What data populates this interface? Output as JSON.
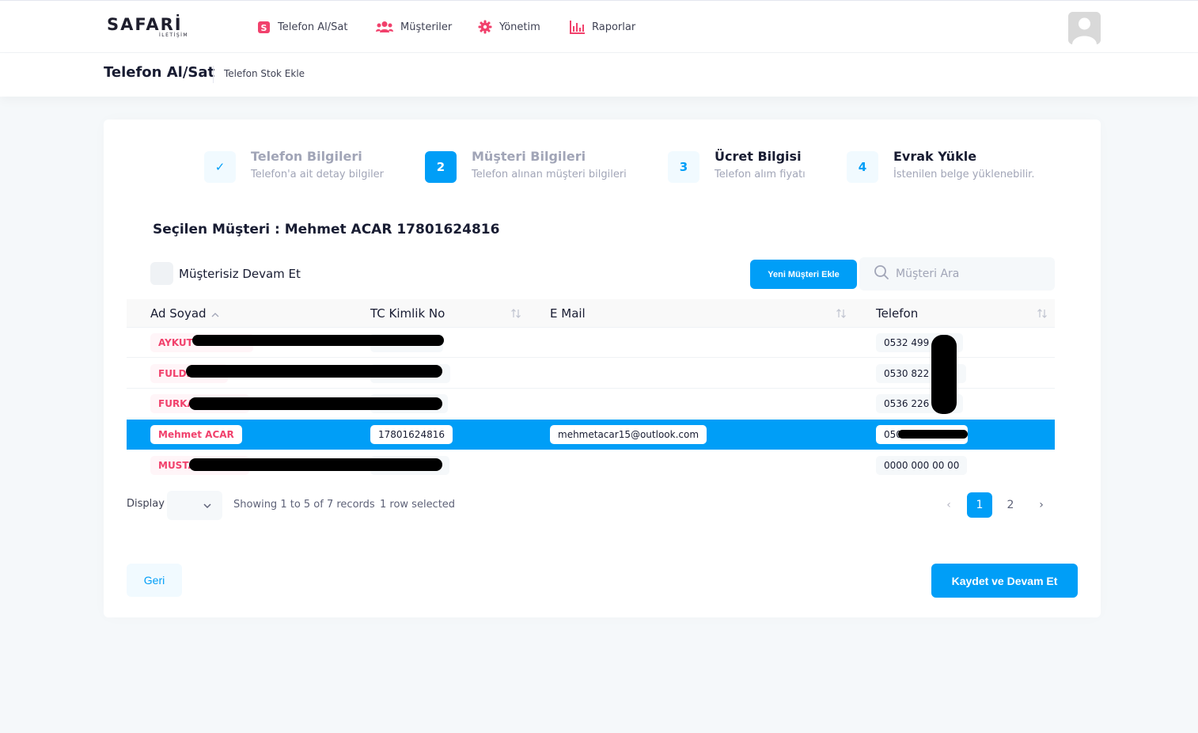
{
  "brand": {
    "name": "SAFARİ",
    "sub": "İLETİŞİM"
  },
  "nav": [
    {
      "label": "Telefon Al/Sat",
      "icon": "dollar-icon"
    },
    {
      "label": "Müşteriler",
      "icon": "users-icon"
    },
    {
      "label": "Yönetim",
      "icon": "gear-icon"
    },
    {
      "label": "Raporlar",
      "icon": "chart-icon"
    }
  ],
  "subheader": {
    "title": "Telefon Al/Sat",
    "crumb": "Telefon Stok Ekle"
  },
  "steps": [
    {
      "num": "✓",
      "title": "Telefon Bilgileri",
      "desc": "Telefon'a ait detay bilgiler"
    },
    {
      "num": "2",
      "title": "Müşteri Bilgileri",
      "desc": "Telefon alınan müşteri bilgileri"
    },
    {
      "num": "3",
      "title": "Ücret Bilgisi",
      "desc": "Telefon alım fiyatı"
    },
    {
      "num": "4",
      "title": "Evrak Yükle",
      "desc": "İstenilen belge yüklenebilir."
    }
  ],
  "selected_customer": "Seçilen Müşteri : Mehmet ACAR 17801624816",
  "no_customer_label": "Müşterisiz Devam Et",
  "new_customer_button": "Yeni Müşteri Ekle",
  "search": {
    "placeholder": "Müşteri Ara",
    "value": ""
  },
  "table": {
    "columns": [
      "Ad Soyad",
      "TC Kimlik No",
      "E Mail",
      "Telefon"
    ],
    "rows": [
      {
        "name": "AYKUT",
        "tc": "",
        "email": "",
        "phone": "0532 499",
        "selected": false
      },
      {
        "name": "FULDE",
        "tc": "",
        "email": "",
        "phone": "0530 822",
        "selected": false
      },
      {
        "name": "FURKA",
        "tc": "",
        "email": "",
        "phone": "0536 226",
        "selected": false
      },
      {
        "name": "Mehmet ACAR",
        "tc": "17801624816",
        "email": "mehmetacar15@outlook.com",
        "phone": "050",
        "selected": true
      },
      {
        "name": "MUSTA",
        "tc": "",
        "email": "",
        "phone": "0000 000 00 00",
        "selected": false
      }
    ]
  },
  "footer": {
    "display_label": "Display",
    "display_value": "",
    "showing": "Showing 1 to 5 of 7 records",
    "selected_info": "1 row selected",
    "pages": [
      "1",
      "2"
    ],
    "prev": "‹",
    "next": "›"
  },
  "buttons": {
    "back": "Geri",
    "save": "Kaydet ve Devam Et"
  },
  "colors": {
    "primary": "#009ef7",
    "danger": "#f1416c",
    "background": "#f5f8fa"
  }
}
